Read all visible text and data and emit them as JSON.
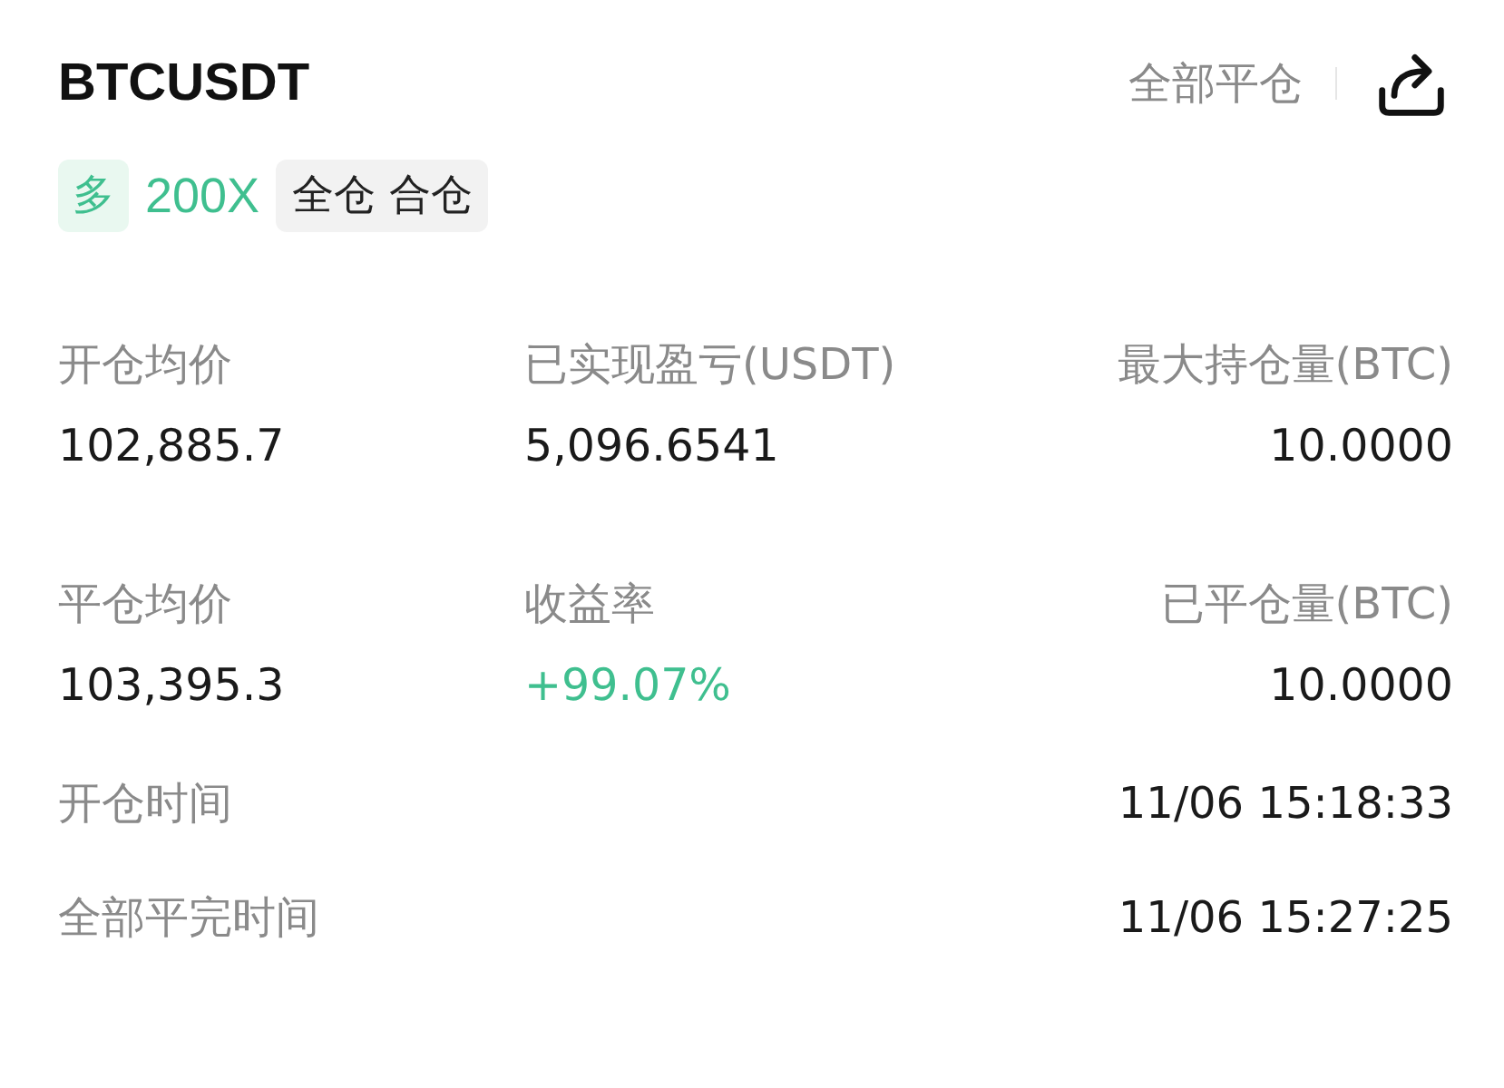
{
  "header": {
    "symbol": "BTCUSDT",
    "close_all": "全部平仓"
  },
  "tags": [
    {
      "kind": "side",
      "text": "多"
    },
    {
      "kind": "leverage",
      "text": "200X"
    },
    {
      "kind": "margin",
      "text": "全仓 合仓"
    }
  ],
  "stats": [
    {
      "label": "开仓均价",
      "value": "102,885.7",
      "color": "#1a1a1a"
    },
    {
      "label": "已实现盈亏(USDT)",
      "value": "5,096.6541",
      "color": "#1a1a1a"
    },
    {
      "label": "最大持仓量(BTC)",
      "value": "10.0000",
      "color": "#1a1a1a"
    },
    {
      "label": "平仓均价",
      "value": "103,395.3",
      "color": "#1a1a1a"
    },
    {
      "label": "收益率",
      "value": "+99.07%",
      "color": "#3fbf8f"
    },
    {
      "label": "已平仓量(BTC)",
      "value": "10.0000",
      "color": "#1a1a1a"
    }
  ],
  "times": [
    {
      "label": "开仓时间",
      "value": "11/06 15:18:33"
    },
    {
      "label": "全部平完时间",
      "value": "11/06 15:27:25"
    }
  ]
}
